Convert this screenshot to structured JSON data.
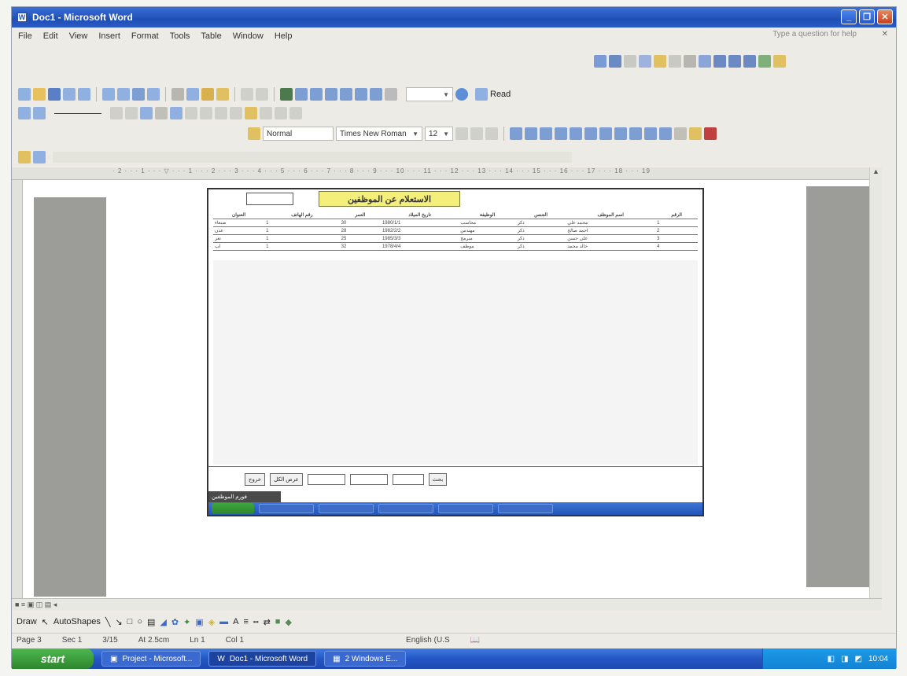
{
  "window": {
    "title": "Doc1 - Microsoft Word"
  },
  "menu": [
    "File",
    "Edit",
    "View",
    "Insert",
    "Format",
    "Tools",
    "Table",
    "Window",
    "Help"
  ],
  "help_prompt": "Type a question for help",
  "formatting": {
    "style": "Normal",
    "font": "Times New Roman",
    "size": "12",
    "read_label": "Read"
  },
  "embed": {
    "heading": "الاستعلام عن الموظفين",
    "table_headers": [
      "الرقم",
      "اسم الموظف",
      "الجنس",
      "الوظيفة",
      "تاريخ الميلاد",
      "العمر",
      "رقم الهاتف",
      "العنوان"
    ],
    "rows": [
      [
        "1",
        "محمد علي",
        "ذكر",
        "محاسب",
        "1980/1/1",
        "30",
        "1",
        "صنعاء"
      ],
      [
        "2",
        "احمد صالح",
        "ذكر",
        "مهندس",
        "1982/2/2",
        "28",
        "1",
        "عدن"
      ],
      [
        "3",
        "علي حسن",
        "ذكر",
        "مبرمج",
        "1985/3/3",
        "25",
        "1",
        "تعز"
      ],
      [
        "4",
        "خالد محمد",
        "ذكر",
        "موظف",
        "1978/4/4",
        "32",
        "1",
        "اب"
      ]
    ],
    "form_label": "فورم الموظفين",
    "footer_buttons": [
      "بحث",
      "عرض الكل",
      "خروج"
    ]
  },
  "drawbar": {
    "draw": "Draw",
    "autoshapes": "AutoShapes"
  },
  "status": {
    "page": "Page 3",
    "sec": "Sec 1",
    "pages": "3/15",
    "at": "At 2.5cm",
    "ln": "Ln 1",
    "col": "Col 1",
    "lang": "English (U.S"
  },
  "taskbar": {
    "start": "start",
    "tasks": [
      "Project - Microsoft...",
      "Doc1 - Microsoft Word",
      "2 Windows E..."
    ],
    "clock": "10:04"
  }
}
